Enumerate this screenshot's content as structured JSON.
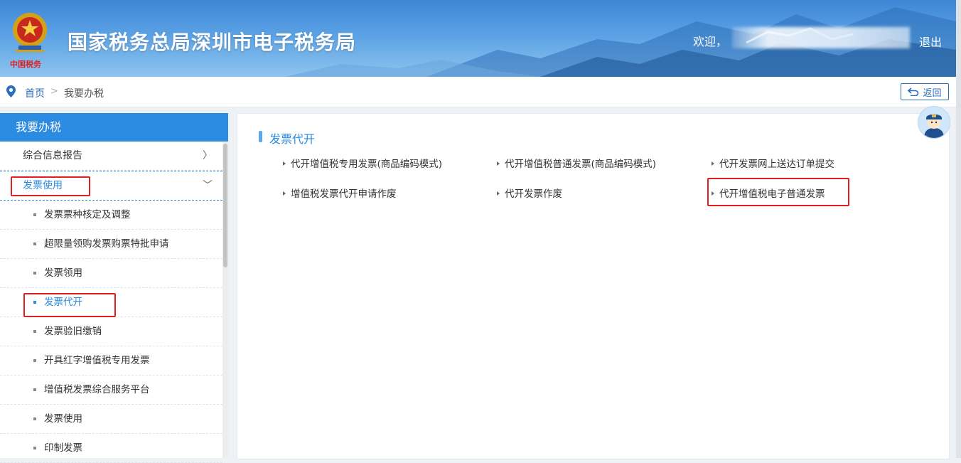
{
  "header": {
    "title": "国家税务总局深圳市电子税务局",
    "emblem_caption": "中国税务",
    "welcome": "欢迎，",
    "logout": "退出"
  },
  "breadcrumb": {
    "home": "首页",
    "separator": ">",
    "current": "我要办税",
    "back_label": "返回"
  },
  "sidebar": {
    "title": "我要办税",
    "items": [
      {
        "label": "综合信息报告",
        "arrow": "〉"
      },
      {
        "label": "发票使用",
        "arrow": "﹀"
      }
    ],
    "sub_items": [
      "发票票种核定及调整",
      "超限量领购发票购票特批申请",
      "发票领用",
      "发票代开",
      "发票验旧缴销",
      "开具红字增值税专用发票",
      "增值税发票综合服务平台",
      "发票使用",
      "印制发票"
    ]
  },
  "main": {
    "section_title": "发票代开",
    "links": [
      "代开增值税专用发票(商品编码模式)",
      "代开增值税普通发票(商品编码模式)",
      "代开发票网上送达订单提交",
      "增值税发票代开申请作废",
      "代开发票作废",
      "代开增值税电子普通发票"
    ]
  },
  "colors": {
    "accent": "#2a8be0",
    "highlight_box": "#e02020",
    "header_blue": "#3f86d6"
  }
}
